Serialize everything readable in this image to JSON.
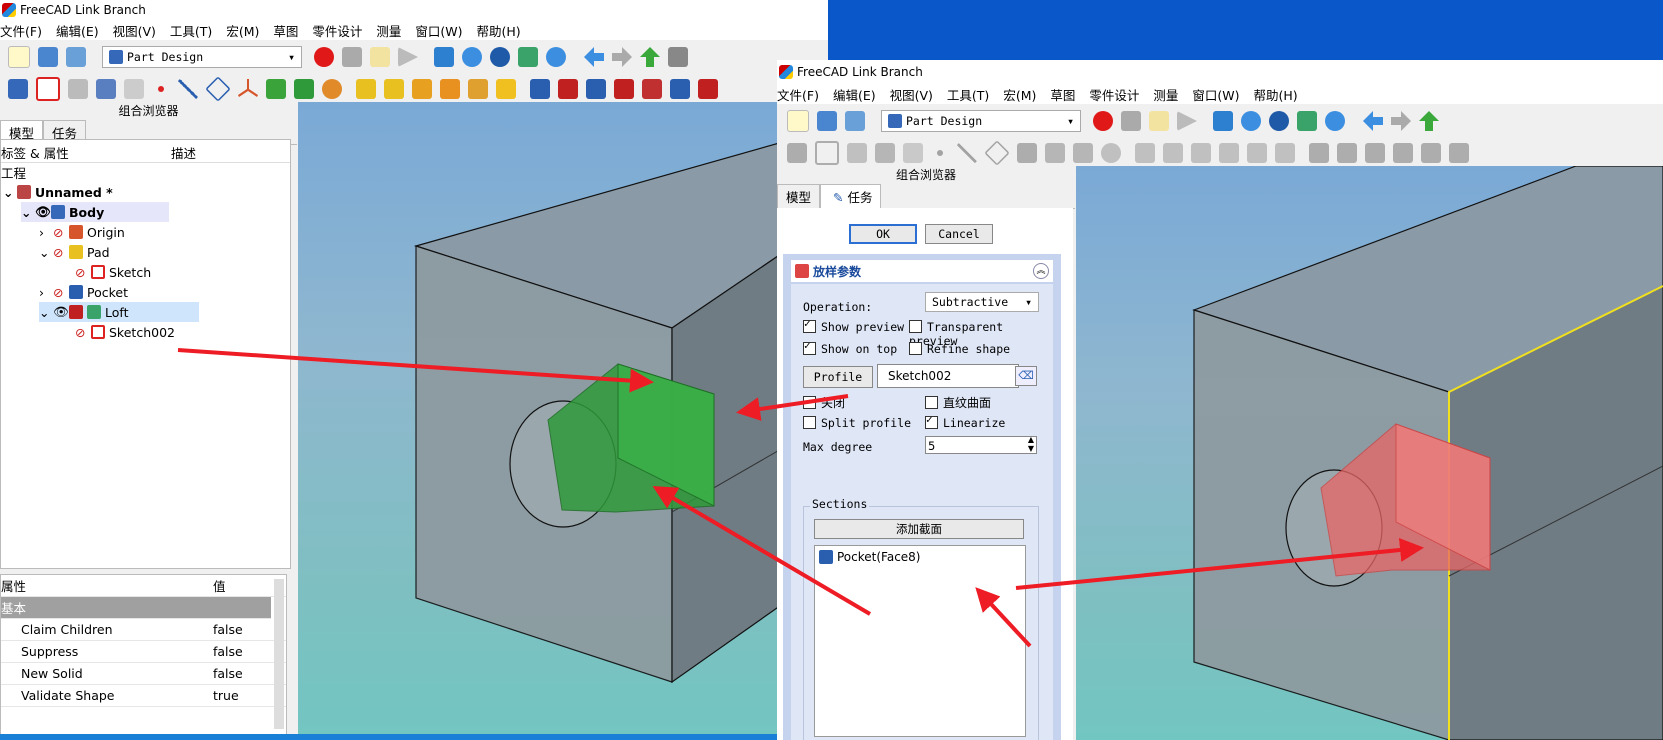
{
  "win1": {
    "title": "FreeCAD Link Branch",
    "menus": [
      "文件(F)",
      "编辑(E)",
      "视图(V)",
      "工具(T)",
      "宏(M)",
      "草图",
      "零件设计",
      "测量",
      "窗口(W)",
      "帮助(H)"
    ],
    "workbench": "Part Design",
    "combo_title": "组合浏览器",
    "tabs": [
      "模型",
      "任务"
    ],
    "tree_headers": {
      "label": "标签 & 属性",
      "desc": "描述"
    },
    "tree_section": "工程",
    "tree": [
      {
        "label": "Unnamed *"
      },
      {
        "label": "Body"
      },
      {
        "label": "Origin"
      },
      {
        "label": "Pad"
      },
      {
        "label": "Sketch"
      },
      {
        "label": "Pocket"
      },
      {
        "label": "Loft"
      },
      {
        "label": "Sketch002"
      }
    ],
    "prop_headers": {
      "name": "属性",
      "value": "值"
    },
    "prop_group": "基本",
    "props": [
      {
        "name": "Claim Children",
        "value": "false"
      },
      {
        "name": "Suppress",
        "value": "false"
      },
      {
        "name": "New Solid",
        "value": "false"
      },
      {
        "name": "Validate Shape",
        "value": "true"
      }
    ]
  },
  "win2": {
    "title": "FreeCAD Link Branch",
    "menus": [
      "文件(F)",
      "编辑(E)",
      "视图(V)",
      "工具(T)",
      "宏(M)",
      "草图",
      "零件设计",
      "测量",
      "窗口(W)",
      "帮助(H)"
    ],
    "workbench": "Part Design",
    "combo_title": "组合浏览器",
    "tabs": [
      "模型",
      "任务"
    ],
    "ok": "OK",
    "cancel": "Cancel",
    "panel_title": "放样参数",
    "operation_label": "Operation:",
    "operation_value": "Subtractive",
    "show_preview": "Show preview",
    "transparent_preview": "Transparent preview",
    "show_on_top": "Show on top",
    "refine_shape": "Refine shape",
    "profile_btn": "Profile",
    "profile_value": "Sketch002",
    "closed": "关闭",
    "ruled": "直纹曲面",
    "split_profile": "Split profile",
    "linearize": "Linearize",
    "max_degree_label": "Max degree",
    "max_degree_value": "5",
    "sections_label": "Sections",
    "add_section": "添加截面",
    "section_item": "Pocket(Face8)"
  },
  "colors": {
    "desktop": "#0a57c9",
    "loft_add": "#2f9a3a",
    "loft_sub": "#e86666",
    "arrow": "#ee1c24",
    "task_bg": "#c5d3ee",
    "selected_edge": "#f0e020"
  }
}
